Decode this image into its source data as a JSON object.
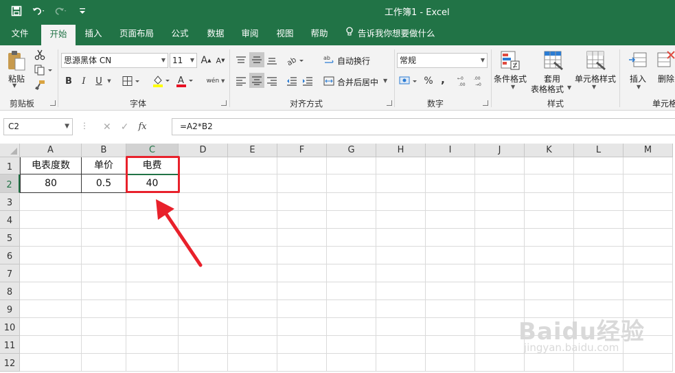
{
  "window": {
    "title": "工作簿1  -  Excel"
  },
  "quick_access": {
    "save": "save-icon",
    "undo": "undo-icon",
    "redo": "redo-icon",
    "customize": "customize-icon"
  },
  "tabs": [
    {
      "label": "文件"
    },
    {
      "label": "开始"
    },
    {
      "label": "插入"
    },
    {
      "label": "页面布局"
    },
    {
      "label": "公式"
    },
    {
      "label": "数据"
    },
    {
      "label": "审阅"
    },
    {
      "label": "视图"
    },
    {
      "label": "帮助"
    }
  ],
  "tell_me": "告诉我你想要做什么",
  "ribbon": {
    "clipboard": {
      "paste": "粘贴",
      "group": "剪贴板"
    },
    "font": {
      "name": "思源黑体 CN",
      "size": "11",
      "bold": "B",
      "italic": "I",
      "underline": "U",
      "grow": "A",
      "shrink": "A",
      "font_color": "A",
      "phonetic": "wén",
      "group": "字体"
    },
    "alignment": {
      "wrap": "自动换行",
      "merge": "合并后居中",
      "group": "对齐方式"
    },
    "number": {
      "format": "常规",
      "percent": "%",
      "comma": ",",
      "inc_dec": ".00",
      "dec_dec": ".0",
      "group": "数字"
    },
    "styles": {
      "conditional": "条件格式",
      "table_line1": "套用",
      "table_line2": "表格格式",
      "cell_styles": "单元格样式",
      "group": "样式"
    },
    "cells": {
      "insert": "插入",
      "delete": "删除",
      "group": "单元格"
    }
  },
  "formula_bar": {
    "name_box": "C2",
    "formula": "=A2*B2",
    "fx": "fx",
    "cancel": "✕",
    "enter": "✓"
  },
  "sheet": {
    "columns": [
      "A",
      "B",
      "C",
      "D",
      "E",
      "F",
      "G",
      "H",
      "I",
      "J",
      "K",
      "L",
      "M"
    ],
    "selected_column": "C",
    "rows": [
      "1",
      "2",
      "3",
      "4",
      "5",
      "6",
      "7",
      "8",
      "9",
      "10",
      "11",
      "12"
    ],
    "selected_row": "2",
    "cells": {
      "A1": "电表度数",
      "B1": "单价",
      "C1": "电费",
      "A2": "80",
      "B2": "0.5",
      "C2": "40"
    }
  },
  "annotation": {
    "highlight_color": "#e8212b",
    "arrow_color": "#e8212b"
  },
  "watermark": {
    "text": "Baidu经验",
    "url": "jingyan.baidu.com"
  },
  "colors": {
    "excel_green": "#217346",
    "ribbon_bg": "#f3f3f3"
  }
}
